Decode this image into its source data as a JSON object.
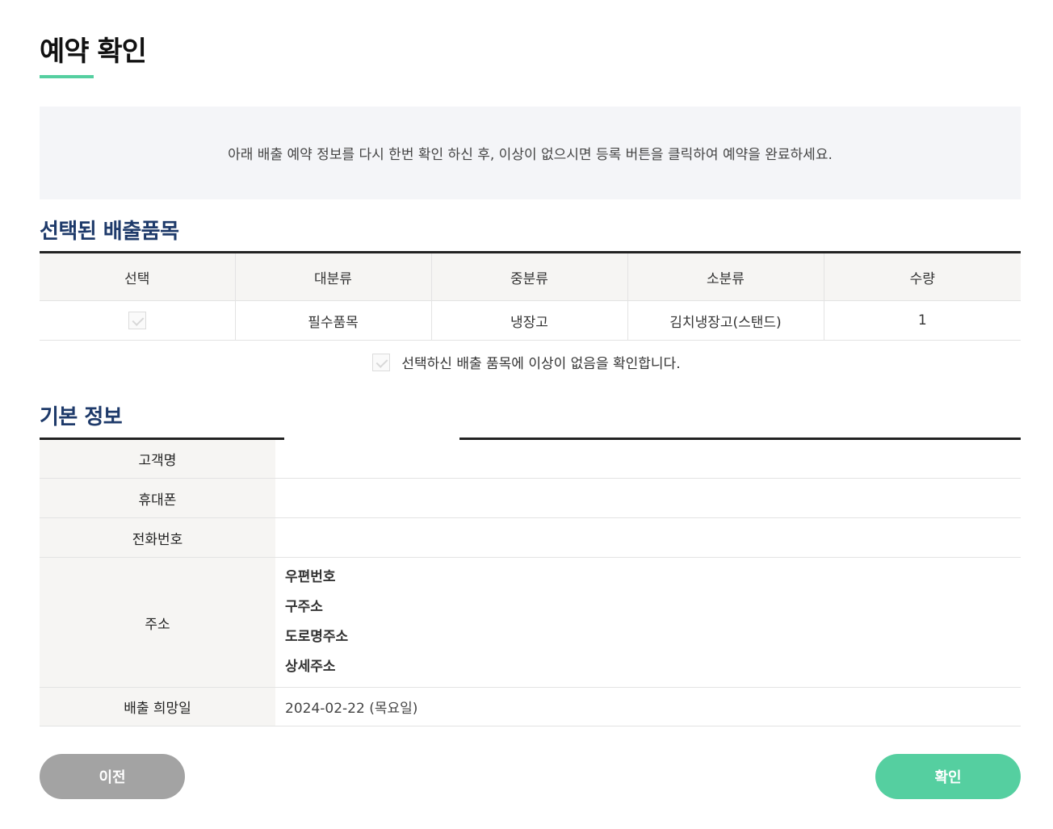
{
  "page": {
    "title": "예약 확인"
  },
  "notice": "아래 배출 예약 정보를 다시 한번 확인 하신 후, 이상이 없으시면 등록 버튼을 클릭하여 예약을 완료하세요.",
  "items_section": {
    "title": "선택된 배출품목",
    "headers": [
      "선택",
      "대분류",
      "중분류",
      "소분류",
      "수량"
    ],
    "rows": [
      {
        "checked": true,
        "major": "필수품목",
        "middle": "냉장고",
        "minor": "김치냉장고(스탠드)",
        "qty": "1"
      }
    ],
    "confirm_label": "선택하신 배출 품목에 이상이 없음을 확인합니다."
  },
  "info_section": {
    "title": "기본 정보",
    "customer_label": "고객명",
    "customer_value": "",
    "mobile_label": "휴대폰",
    "mobile_value": "",
    "phone_label": "전화번호",
    "phone_value": "",
    "address_label": "주소",
    "address_fields": [
      "우편번호",
      "구주소",
      "도로명주소",
      "상세주소"
    ],
    "date_label": "배출 희망일",
    "date_value": "2024-02-22 (목요일)"
  },
  "buttons": {
    "prev": "이전",
    "confirm": "확인"
  },
  "colors": {
    "accent": "#55cfa0",
    "section_title": "#1e3a6a",
    "prev_button": "#a3a3a3"
  }
}
